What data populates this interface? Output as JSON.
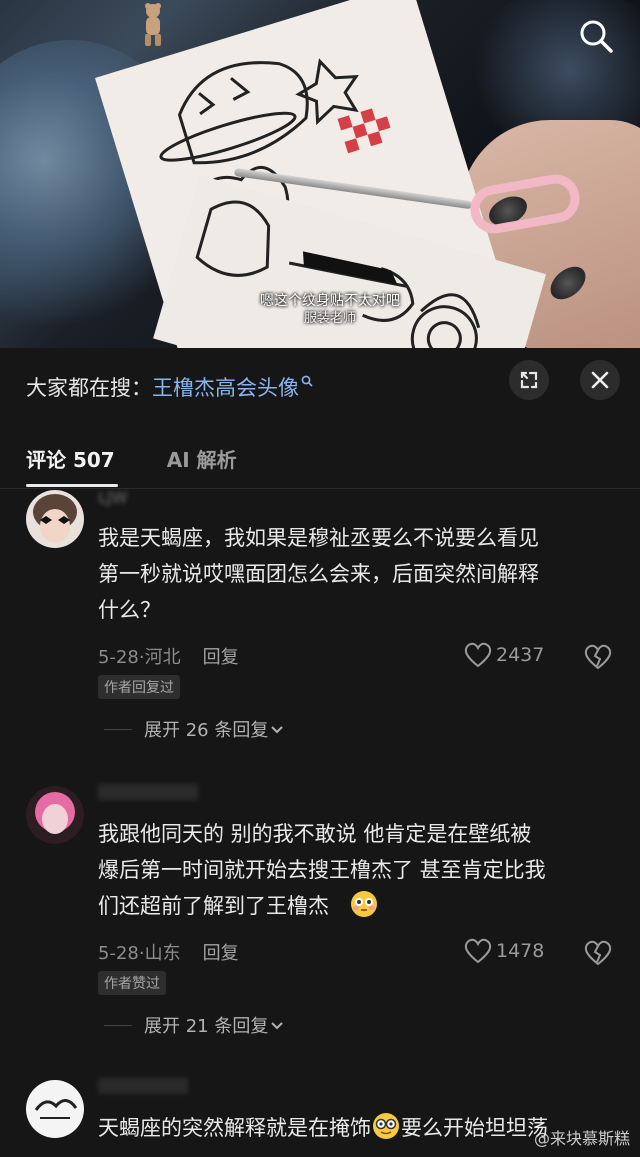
{
  "video": {
    "subtitle_line1": "嗯这个纹身贴不太对吧",
    "subtitle_line2": "服装老师"
  },
  "search": {
    "prefix": "大家都在搜：",
    "keyword": "王橹杰高会头像"
  },
  "tabs": [
    {
      "label": "评论 507"
    },
    {
      "label": "AI 解析"
    }
  ],
  "comments": [
    {
      "username": "LJW",
      "lines": [
        "我是天蝎座，我如果是穆祉丞要么不说要么看见",
        "第一秒就说哎嘿面团怎么会来，后面突然间解释",
        "什么？"
      ],
      "date": "5-28",
      "location": "河北",
      "reply_label": "回复",
      "likes": "2437",
      "badge": "作者回复过",
      "expand_label": "展开 26 条回复"
    },
    {
      "username": "",
      "lines": [
        "我跟他同天的 别的我不敢说 他肯定是在壁纸被",
        "爆后第一时间就开始去搜王橹杰了 甚至肯定比我",
        "们还超前了解到了王橹杰"
      ],
      "date": "5-28",
      "location": "山东",
      "reply_label": "回复",
      "likes": "1478",
      "badge": "作者赞过",
      "expand_label": "展开 21 条回复"
    },
    {
      "username": "",
      "line_a": "天蝎座的突然解释就是在掩饰",
      "line_b": "要么开始坦坦荡"
    }
  ],
  "watermark": "@来块慕斯糕",
  "colors": {
    "accent_link": "#8ab4ec",
    "background": "#161616"
  },
  "icons": [
    "search-icon",
    "expand-icon",
    "close-icon",
    "heart-icon",
    "broken-heart-icon",
    "chevron-down-icon"
  ]
}
